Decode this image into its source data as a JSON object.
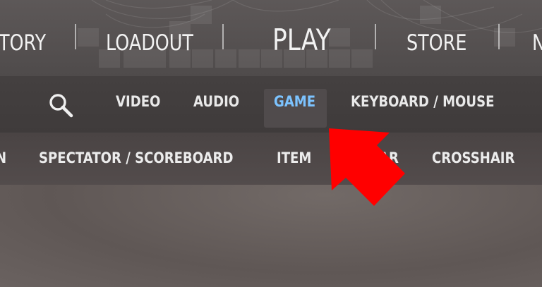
{
  "top_nav": {
    "items": [
      {
        "label": "TORY"
      },
      {
        "label": "LOADOUT"
      },
      {
        "label": "PLAY"
      },
      {
        "label": "STORE"
      },
      {
        "label": "N"
      }
    ]
  },
  "settings_tabs": {
    "search_icon": "search-icon",
    "items": [
      {
        "label": "VIDEO"
      },
      {
        "label": "AUDIO"
      },
      {
        "label": "GAME",
        "active": true
      },
      {
        "label": "KEYBOARD / MOUSE"
      }
    ],
    "active_color": "#7cc3ff"
  },
  "sub_tabs": {
    "items": [
      {
        "label": "N"
      },
      {
        "label": "SPECTATOR / SCOREBOARD"
      },
      {
        "label": "ITEM"
      },
      {
        "label": "AR"
      },
      {
        "label": "CROSSHAIR"
      }
    ]
  },
  "annotation": {
    "arrow_icon": "red-arrow-icon",
    "arrow_color": "#ff0000"
  }
}
